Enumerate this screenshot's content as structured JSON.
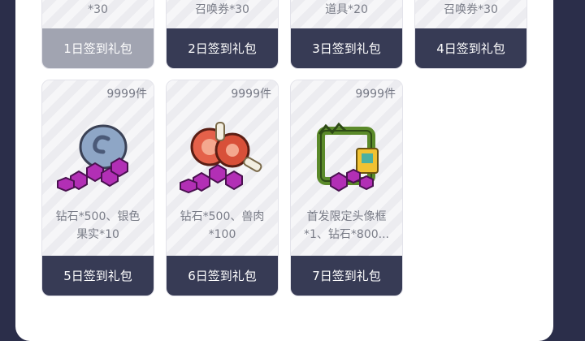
{
  "top_row": [
    {
      "desc": "*30",
      "label": "1日签到礼包",
      "claimed": true
    },
    {
      "desc": "召唤券*30",
      "label": "2日签到礼包",
      "claimed": false
    },
    {
      "desc": "道具*20",
      "label": "3日签到礼包",
      "claimed": false
    },
    {
      "desc": "召唤券*30",
      "label": "4日签到礼包",
      "claimed": false
    }
  ],
  "bottom_row": [
    {
      "count": "9999件",
      "desc_line1": "钻石*500、银色",
      "desc_line2": "果实*10",
      "label": "5日签到礼包",
      "icon": "silver-fruit-diamonds-icon"
    },
    {
      "count": "9999件",
      "desc_line1": "钻石*500、兽肉",
      "desc_line2": "*100",
      "label": "6日签到礼包",
      "icon": "meat-diamonds-icon"
    },
    {
      "count": "9999件",
      "desc_line1": "首发限定头像框",
      "desc_line2": "*1、钻石*800...",
      "label": "7日签到礼包",
      "icon": "avatar-frame-diamonds-icon"
    }
  ]
}
